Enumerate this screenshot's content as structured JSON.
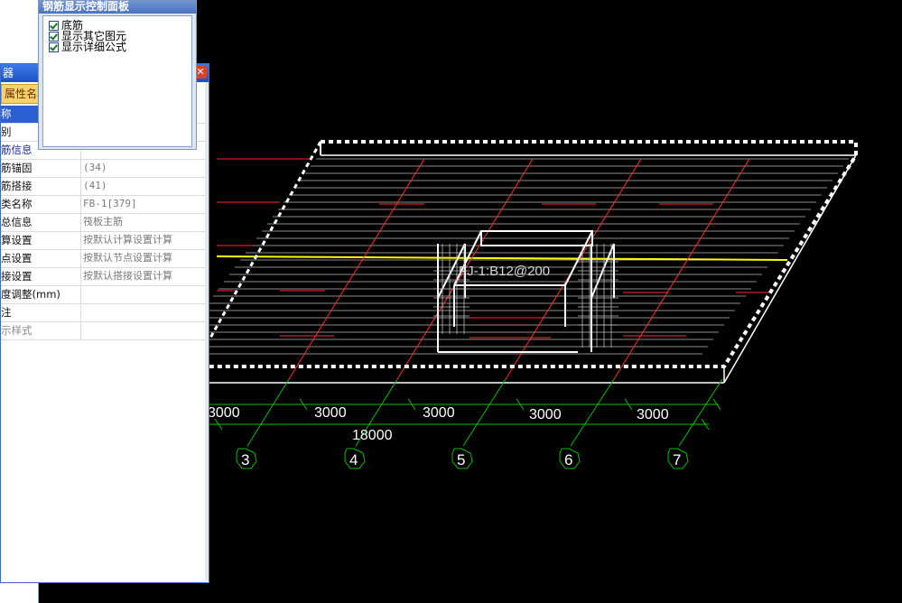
{
  "rebar_panel": {
    "title": "钢筋显示控制面板",
    "items": [
      {
        "label": "底筋",
        "checked": true
      },
      {
        "label": "显示其它图元",
        "checked": true
      },
      {
        "label": "显示详细公式",
        "checked": true
      }
    ]
  },
  "prop_panel": {
    "title": "器",
    "header_tab": "属性名称",
    "rows": [
      {
        "name": "称",
        "value": ""
      },
      {
        "name": "别",
        "value": ""
      },
      {
        "name": "筋信息",
        "value": ""
      },
      {
        "name": "筋锚固",
        "value": "(34)"
      },
      {
        "name": "筋搭接",
        "value": "(41)"
      },
      {
        "name": "类名称",
        "value": "FB-1[379]"
      },
      {
        "name": "总信息",
        "value": "筏板主筋"
      },
      {
        "name": "算设置",
        "value": "按默认计算设置计算"
      },
      {
        "name": "点设置",
        "value": "按默认节点设置计算"
      },
      {
        "name": "接设置",
        "value": "按默认搭接设置计算"
      },
      {
        "name": "度调整(mm)",
        "value": ""
      },
      {
        "name": "注",
        "value": ""
      },
      {
        "name": "示样式",
        "value": ""
      }
    ]
  },
  "viewport": {
    "rebar_label": "FJ-1:B12@200",
    "dimensions": [
      "3000",
      "3000",
      "3000",
      "3000",
      "3000"
    ],
    "total_dimension": "18000",
    "axes": [
      "3",
      "4",
      "5",
      "6",
      "7"
    ],
    "colors": {
      "slab": "#ffffff",
      "rebar": "#ff3030",
      "grid": "#00c000",
      "highlight": "#ffff00"
    }
  }
}
